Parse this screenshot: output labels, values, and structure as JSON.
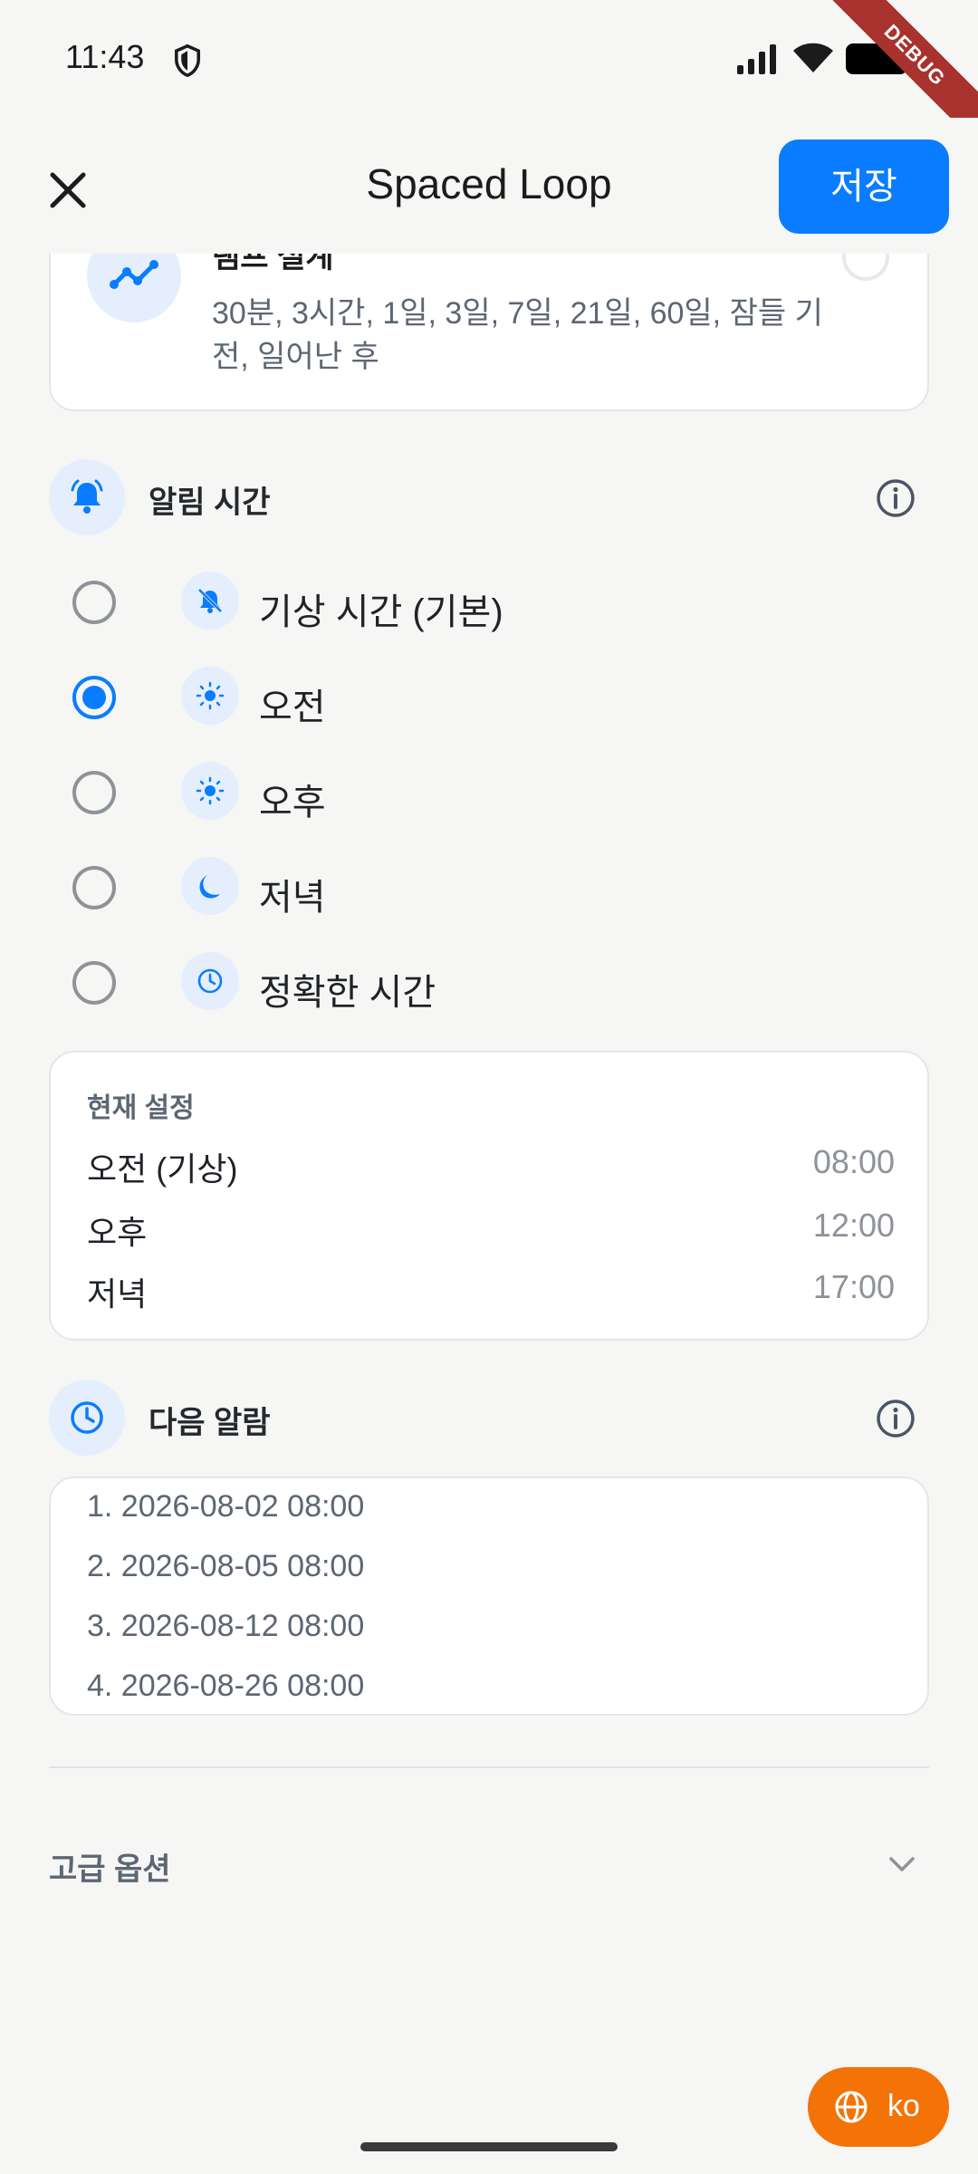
{
  "status_bar": {
    "time": "11:43",
    "debug_label": "DEBUG"
  },
  "app_bar": {
    "title": "Spaced Loop",
    "save_label": "저장"
  },
  "pattern_card": {
    "title": "램프 설계",
    "description": "30분, 3시간, 1일, 3일, 7일, 21일, 60일, 잠들 기 전, 일어난 후"
  },
  "alarm_time": {
    "title": "알림 시간",
    "options": [
      {
        "label": "기상 시간 (기본)",
        "icon": "bell-off-icon",
        "selected": false
      },
      {
        "label": "오전",
        "icon": "sun-icon",
        "selected": true
      },
      {
        "label": "오후",
        "icon": "sun-icon",
        "selected": false
      },
      {
        "label": "저녁",
        "icon": "moon-icon",
        "selected": false
      },
      {
        "label": "정확한 시간",
        "icon": "clock-icon",
        "selected": false
      }
    ]
  },
  "current_settings": {
    "title": "현재 설정",
    "rows": [
      {
        "label": "오전 (기상)",
        "value": "08:00"
      },
      {
        "label": "오후",
        "value": "12:00"
      },
      {
        "label": "저녁",
        "value": "17:00"
      }
    ]
  },
  "next_alarm": {
    "title": "다음 알람",
    "items": [
      "1. 2026-08-02 08:00",
      "2. 2026-08-05 08:00",
      "3. 2026-08-12 08:00",
      "4. 2026-08-26 08:00"
    ]
  },
  "advanced": {
    "label": "고급 옵션"
  },
  "lang_fab": {
    "label": "ko"
  },
  "colors": {
    "accent": "#0a7cff",
    "fab": "#f37307",
    "icon_bg": "#e5eefc"
  }
}
